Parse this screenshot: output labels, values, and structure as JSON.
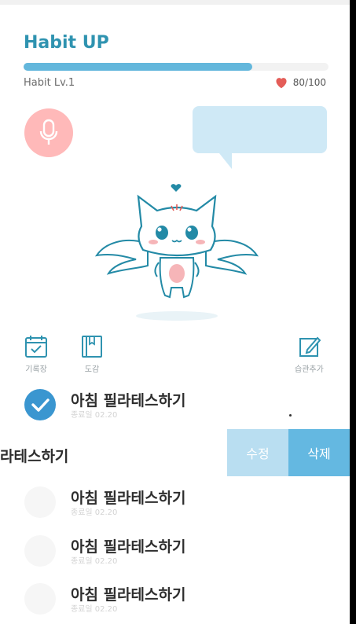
{
  "app": {
    "title": "Habit UP"
  },
  "progress": {
    "fraction": 0.75
  },
  "status": {
    "level": "Habit Lv.1",
    "hp": "80/100",
    "heart_color": "#e45d58"
  },
  "colors": {
    "accent": "#2f93b0",
    "bar": "#63b7dc",
    "mic_bg": "#ffb9b9",
    "bubble": "#cfe9f6",
    "edit": "#b9def1",
    "delete": "#64b8e1"
  },
  "tools": {
    "log": {
      "label": "기록장",
      "icon": "calendar-check-icon"
    },
    "collection": {
      "label": "도감",
      "icon": "book-icon"
    },
    "add_habit": {
      "label": "습관추가",
      "icon": "pencil-icon"
    }
  },
  "habits": [
    {
      "name": "아침 필라테스하기",
      "date": "종료일 02.20",
      "done": true
    },
    {
      "name": "아침 필라테스하기",
      "date": "종료일 02.20",
      "done": false
    },
    {
      "name": "아침 필라테스하기",
      "date": "종료일 02.20",
      "done": false
    },
    {
      "name": "아침 필라테스하기",
      "date": "종료일 02.20",
      "done": false
    }
  ],
  "swipe": {
    "partial_text": "라테스하기",
    "edit_label": "수정",
    "delete_label": "삭제"
  }
}
